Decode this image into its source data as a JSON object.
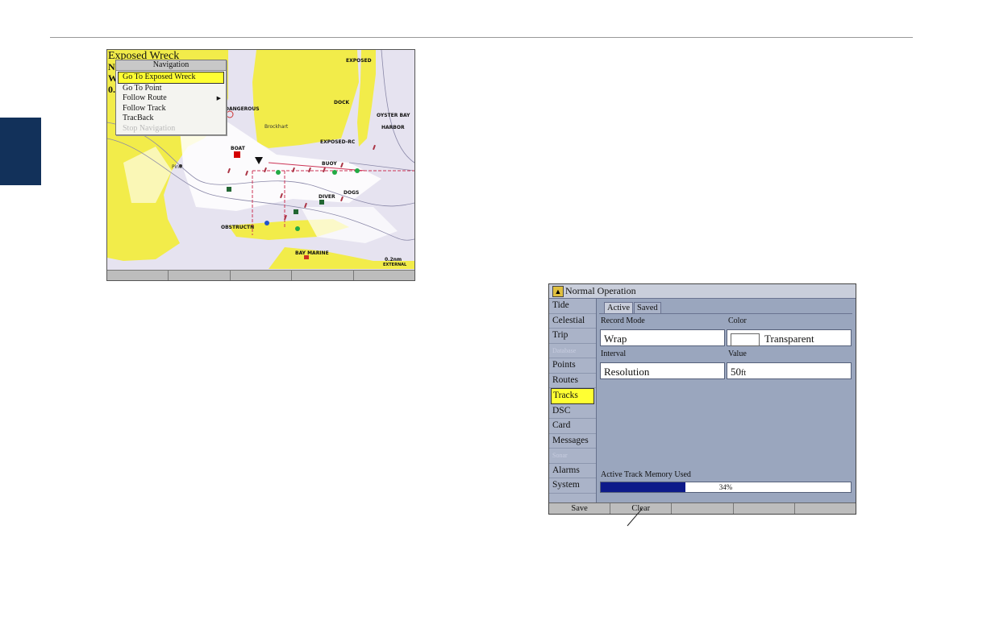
{
  "map_screen": {
    "waypoint_title": "Exposed Wreck",
    "waypoint_letters": [
      "N",
      "W",
      "0."
    ],
    "nav_menu": {
      "title": "Navigation",
      "items": [
        {
          "label": "Go To Exposed Wreck",
          "selected": true,
          "disabled": false
        },
        {
          "label": "Go To Point",
          "selected": false,
          "disabled": false
        },
        {
          "label": "Follow Route",
          "selected": false,
          "disabled": false
        },
        {
          "label": "Follow Track",
          "selected": false,
          "disabled": false
        },
        {
          "label": "TracBack",
          "selected": false,
          "disabled": false
        },
        {
          "label": "Stop Navigation",
          "selected": false,
          "disabled": true
        }
      ]
    },
    "labels": {
      "exposed": "EXPOSED",
      "dangerous": "DANGEROUS",
      "dock": "DOCK",
      "oyster_bay": "OYSTER BAY",
      "harbor": "HARBOR",
      "exposed_rc": "EXPOSED-RC",
      "boat": "BOAT",
      "buoy": "BUOY",
      "diver": "DIVER",
      "dogs": "DOGS",
      "obstruct": "OBSTRUCTN",
      "bay_marine": "BAY MARINE",
      "scale": "0.2nm",
      "overzoom": "EXTERNAL"
    },
    "colors": {
      "land": "#f2ec4a",
      "water": "#e6e3f0",
      "shallow": "#ffffff",
      "route": "#cc3355"
    }
  },
  "tracks_screen": {
    "title": "Normal Operation",
    "sidebar_items": [
      {
        "label": "Tide",
        "selected": false,
        "disabled": false
      },
      {
        "label": "Celestial",
        "selected": false,
        "disabled": false
      },
      {
        "label": "Trip",
        "selected": false,
        "disabled": false
      },
      {
        "label": "Database",
        "selected": false,
        "disabled": true
      },
      {
        "label": "Points",
        "selected": false,
        "disabled": false
      },
      {
        "label": "Routes",
        "selected": false,
        "disabled": false
      },
      {
        "label": "Tracks",
        "selected": true,
        "disabled": false
      },
      {
        "label": "DSC",
        "selected": false,
        "disabled": false
      },
      {
        "label": "Card",
        "selected": false,
        "disabled": false
      },
      {
        "label": "Messages",
        "selected": false,
        "disabled": false
      },
      {
        "label": "Sonar",
        "selected": false,
        "disabled": true
      },
      {
        "label": "Alarms",
        "selected": false,
        "disabled": false
      },
      {
        "label": "System",
        "selected": false,
        "disabled": false
      }
    ],
    "tabs": [
      "Active",
      "Saved"
    ],
    "record_mode_label": "Record Mode",
    "record_mode_value": "Wrap",
    "color_label": "Color",
    "color_value": "Transparent",
    "interval_label": "Interval",
    "interval_value": "Resolution",
    "value_label": "Value",
    "value_value": "50",
    "value_unit": "ft",
    "memory_label": "Active Track Memory Used",
    "memory_percent_text": "34%",
    "memory_fraction": 0.34,
    "softkeys": [
      "Save",
      "Clear",
      "",
      "",
      ""
    ]
  }
}
